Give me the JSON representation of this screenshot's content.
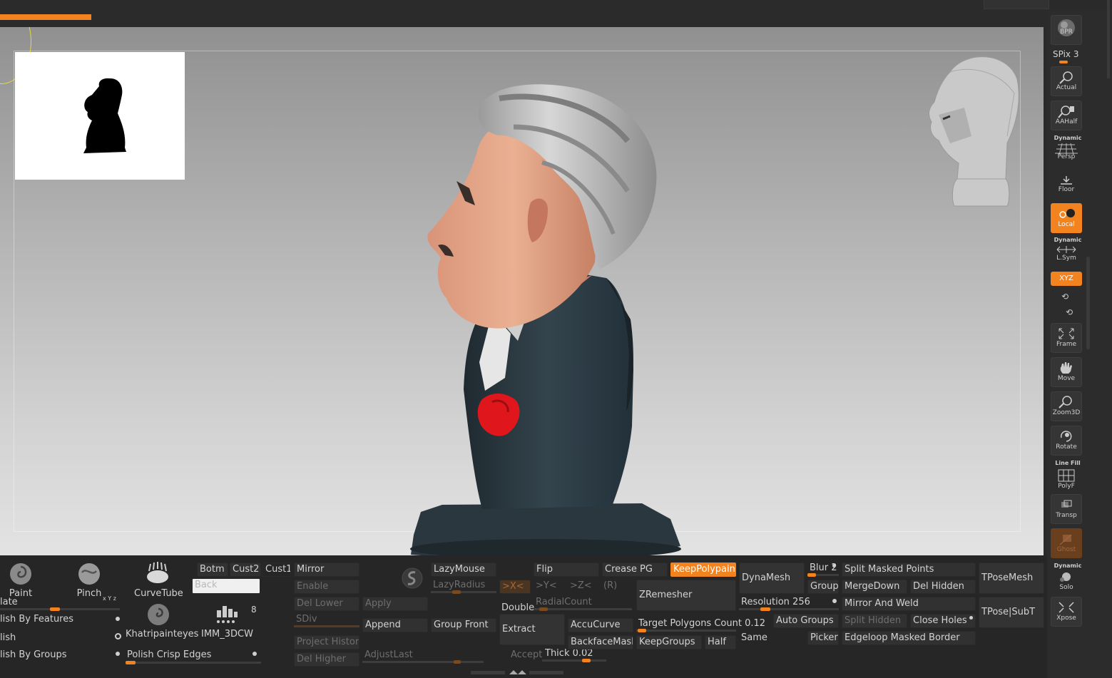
{
  "palette": {
    "accent": "#f3831f",
    "panel": "#262626",
    "button": "#313131",
    "suit": "#2e3b42",
    "skin": "#e6a080",
    "hair": "#b9b9b9",
    "rose": "#e0161d"
  },
  "shelf": {
    "bpr": "BPR",
    "spix": "SPix 3",
    "actual": "Actual",
    "aahalf": "AAHalf",
    "dynamic1": "Dynamic",
    "persp": "Persp",
    "floor": "Floor",
    "local": "Local",
    "dynamic2": "Dynamic",
    "lsym": "L.Sym",
    "xyz": "XYZ",
    "frame": "Frame",
    "move": "Move",
    "zoom3d": "Zoom3D",
    "rotate": "Rotate",
    "linefill": "Line Fill",
    "polyf": "PolyF",
    "transp": "Transp",
    "ghost": "Ghost",
    "dynamic3": "Dynamic",
    "solo": "Solo",
    "xpose": "Xpose"
  },
  "brushes": {
    "paint": "Paint",
    "pinch": "Pinch",
    "curvetube": "CurveTube",
    "khatri": "Khatripainteyes",
    "imm": "IMM_3DCW",
    "imm_count": "8",
    "xyz_mark": "x Y z"
  },
  "left_list": {
    "item1": "late",
    "item2": "lish By Features",
    "item3": "lish",
    "item4": "lish By Groups",
    "polish_crisp": "Polish Crisp Edges"
  },
  "views": {
    "botm": "Botm",
    "cust2": "Cust2",
    "cust1": "Cust1",
    "back": "Back"
  },
  "subtool": {
    "mirror": "Mirror",
    "enable": "Enable",
    "del_lower": "Del Lower",
    "apply": "Apply",
    "sdiv": "SDiv",
    "append": "Append",
    "group_front": "Group Front",
    "project_history": "Project History",
    "del_higher": "Del Higher",
    "adjust_last": "AdjustLast",
    "lazymouse": "LazyMouse",
    "lazyradius": "LazyRadius"
  },
  "symmetry": {
    "x": ">X<",
    "y": ">Y<",
    "z": ">Z<",
    "r": "(R)",
    "flip": "Flip",
    "double": "Double",
    "radialcount": "RadialCount",
    "extract": "Extract",
    "accept": "Accept",
    "thick": "Thick 0.02",
    "thick_value": 0.02
  },
  "curve": {
    "crease_pg": "Crease PG",
    "accucurve": "AccuCurve",
    "backfacemask": "BackfaceMask"
  },
  "zremesher": {
    "keeppolypaint": "KeepPolypaint",
    "zremesher": "ZRemesher",
    "target": "Target Polygons Count 0.12",
    "target_value": 0.12,
    "keepgroups": "KeepGroups",
    "half": "Half",
    "same": "Same"
  },
  "dynamesh": {
    "dynamesh": "DynaMesh",
    "blur": "Blur 2",
    "groups": "Groups",
    "resolution": "Resolution 256",
    "resolution_value": 256,
    "auto_groups": "Auto Groups",
    "picker": "Picker"
  },
  "merge": {
    "split_masked": "Split Masked Points",
    "mergedown": "MergeDown",
    "del_hidden": "Del Hidden",
    "mirror_weld": "Mirror And Weld",
    "split_hidden": "Split Hidden",
    "close_holes": "Close Holes",
    "edgeloop": "Edgeloop Masked Border",
    "tposemesh": "TPoseMesh",
    "tpose_subt": "TPose|SubT"
  }
}
